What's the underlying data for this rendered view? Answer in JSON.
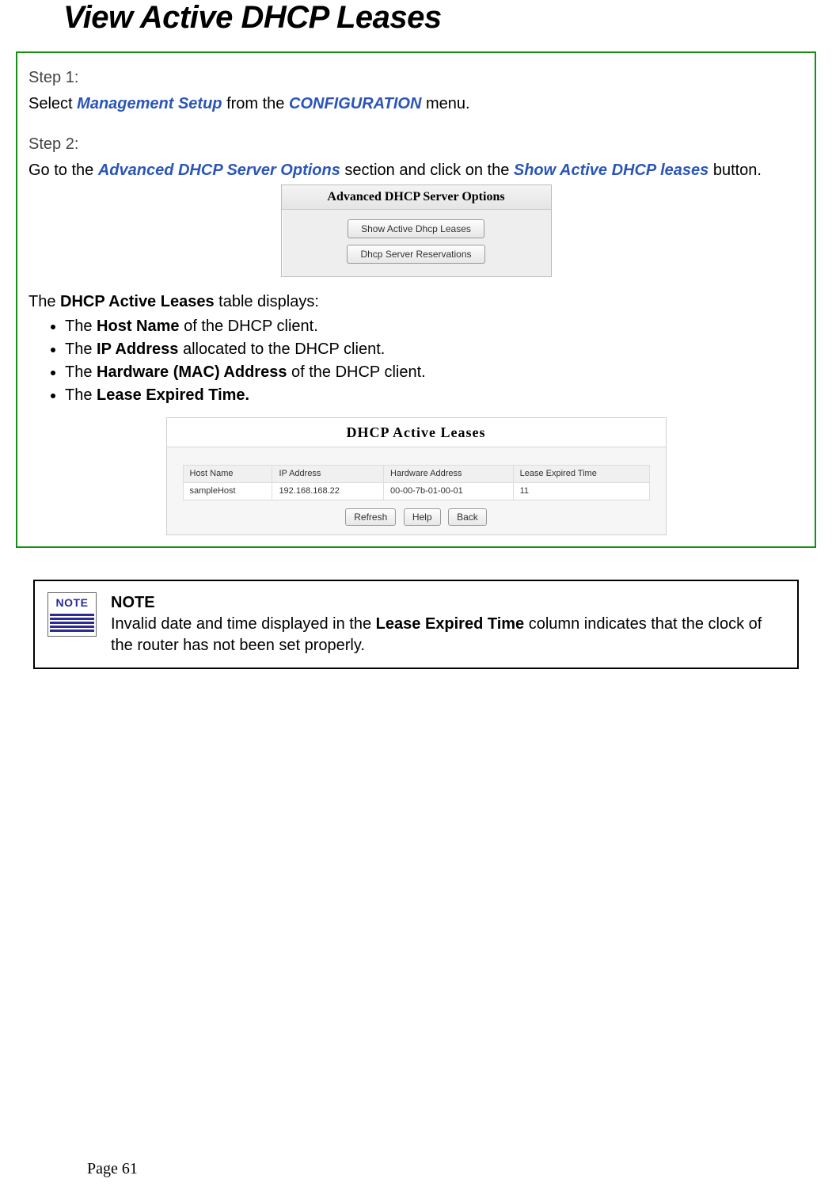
{
  "title": "View Active DHCP Leases",
  "step1": {
    "label": "Step 1:",
    "before": "Select ",
    "keyword1": "Management Setup",
    "mid": " from the ",
    "keyword2": "CONFIGURATION",
    "after": " menu."
  },
  "step2": {
    "label": "Step 2:",
    "before": "Go to the ",
    "keyword1": "Advanced DHCP Server Options",
    "mid": " section and click on the ",
    "keyword2": "Show Active DHCP leases",
    "after": " button."
  },
  "panel1": {
    "title": "Advanced DHCP Server Options",
    "btn1": "Show Active Dhcp Leases",
    "btn2": "Dhcp Server Reservations"
  },
  "lead": {
    "pre": "The ",
    "bold": "DHCP Active Leases",
    "post": " table displays:"
  },
  "bullets": [
    {
      "pre": "The ",
      "bold": "Host Name",
      "post": " of the DHCP client."
    },
    {
      "pre": "The ",
      "bold": "IP Address",
      "post": " allocated to the DHCP client."
    },
    {
      "pre": "The ",
      "bold": "Hardware (MAC) Address",
      "post": " of the DHCP client."
    },
    {
      "pre": "The ",
      "bold": "Lease Expired Time.",
      "post": ""
    }
  ],
  "leases": {
    "title": "DHCP Active Leases",
    "headers": [
      "Host Name",
      "IP Address",
      "Hardware Address",
      "Lease Expired Time"
    ],
    "row": [
      "sampleHost",
      "192.168.168.22",
      "00-00-7b-01-00-01",
      "11"
    ],
    "buttons": [
      "Refresh",
      "Help",
      "Back"
    ]
  },
  "note": {
    "icon_label": "NOTE",
    "heading": "NOTE",
    "body_pre": "Invalid date and time displayed in the ",
    "body_bold": "Lease Expired Time",
    "body_post": " column indicates that the clock of the router has not been set properly."
  },
  "page_number": "Page 61"
}
